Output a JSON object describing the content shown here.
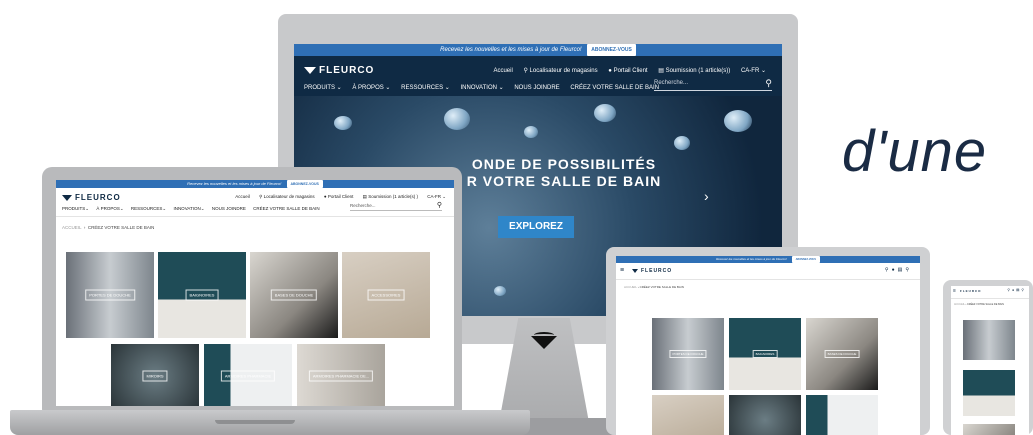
{
  "promo": {
    "text": "Recevez les nouvelles et les mises à jour de Fleurco!",
    "button": "ABONNEZ-VOUS"
  },
  "brand": {
    "name": "FLEURCO"
  },
  "header_links": {
    "home": "Accueil",
    "store_locator": "Localisateur de magasins",
    "client_portal": "Portail Client",
    "quote": "Soumission (1 article(s))",
    "quote_short": "Soumission (1 article(s) )",
    "lang": "CA-FR"
  },
  "nav": {
    "products": "PRODUITS",
    "about": "À PROPOS",
    "resources": "RESSOURCES",
    "innovation": "INNOVATION",
    "contact": "NOUS JOINDRE",
    "build": "CRÉEZ VOTRE SALLE DE BAIN"
  },
  "search": {
    "placeholder": "Recherche..."
  },
  "hero": {
    "line1": "ONDE DE POSSIBILITÉS",
    "line2": "R VOTRE SALLE DE BAIN",
    "cta": "EXPLOREZ"
  },
  "breadcrumb": {
    "home": "ACCUEIL",
    "current": "CRÉEZ VOTRE SALLE DE BAIN"
  },
  "tiles": [
    "PORTES DE DOUCHE",
    "BAIGNOIRES",
    "BASES DE DOUCHE",
    "ACCESSOIRES",
    "MIROIRS",
    "ARMOIRES PHARMACIE",
    "ARMOIRES PHARMACIE DE..."
  ],
  "tagline": "d'une",
  "colors": {
    "navy": "#0f2a44",
    "promo_blue": "#2f6fb5",
    "cta_blue": "#2f86c9"
  }
}
